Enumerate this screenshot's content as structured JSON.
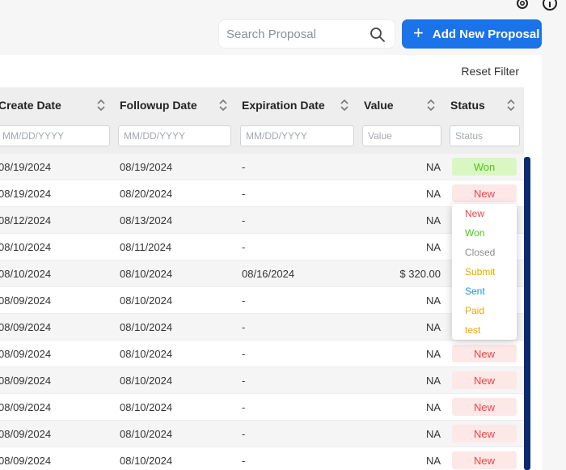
{
  "search": {
    "placeholder": "Search Proposal"
  },
  "add_button": {
    "label": "Add New Proposal"
  },
  "reset_filter": "Reset Filter",
  "columns": {
    "create_date": "Create Date",
    "followup_date": "Followup Date",
    "expiration_date": "Expiration Date",
    "value": "Value",
    "status": "Status"
  },
  "filters": {
    "create_date": "MM/DD/YYYY",
    "followup_date": "MM/DD/YYYY",
    "expiration_date": "MM/DD/YYYY",
    "value": "Value",
    "status": "Status"
  },
  "rows": [
    {
      "create": "08/19/2024",
      "followup": "08/19/2024",
      "expiration": "-",
      "value": "NA",
      "status": "Won"
    },
    {
      "create": "08/19/2024",
      "followup": "08/20/2024",
      "expiration": "-",
      "value": "NA",
      "status": "New"
    },
    {
      "create": "08/12/2024",
      "followup": "08/13/2024",
      "expiration": "-",
      "value": "NA",
      "status": ""
    },
    {
      "create": "08/10/2024",
      "followup": "08/11/2024",
      "expiration": "-",
      "value": "NA",
      "status": ""
    },
    {
      "create": "08/10/2024",
      "followup": "08/10/2024",
      "expiration": "08/16/2024",
      "value": "$ 320.00",
      "status": ""
    },
    {
      "create": "08/09/2024",
      "followup": "08/10/2024",
      "expiration": "-",
      "value": "NA",
      "status": ""
    },
    {
      "create": "08/09/2024",
      "followup": "08/10/2024",
      "expiration": "-",
      "value": "NA",
      "status": ""
    },
    {
      "create": "08/09/2024",
      "followup": "08/10/2024",
      "expiration": "-",
      "value": "NA",
      "status": "New"
    },
    {
      "create": "08/09/2024",
      "followup": "08/10/2024",
      "expiration": "-",
      "value": "NA",
      "status": "New"
    },
    {
      "create": "08/09/2024",
      "followup": "08/10/2024",
      "expiration": "-",
      "value": "NA",
      "status": "New"
    },
    {
      "create": "08/09/2024",
      "followup": "08/10/2024",
      "expiration": "-",
      "value": "NA",
      "status": "New"
    },
    {
      "create": "08/09/2024",
      "followup": "08/10/2024",
      "expiration": "-",
      "value": "NA",
      "status": "New"
    }
  ],
  "status_dropdown": [
    {
      "label": "New",
      "color": "#f04444"
    },
    {
      "label": "Won",
      "color": "#52c41a"
    },
    {
      "label": "Closed",
      "color": "#8c8c8c"
    },
    {
      "label": "Submit",
      "color": "#e8a800"
    },
    {
      "label": "Sent",
      "color": "#1890ff"
    },
    {
      "label": "Paid",
      "color": "#e8a800"
    },
    {
      "label": "test",
      "color": "#e8a800"
    }
  ],
  "colors": {
    "primary": "#1a73e8",
    "won_bg": "#d9f7c3",
    "won_text": "#52c41a",
    "new_bg": "#fde8e8",
    "new_text": "#f04444",
    "scrollbar": "#0b2a6f"
  },
  "icons": {
    "top": [
      "gear-icon",
      "info-icon"
    ],
    "search": "search-icon",
    "add": "plus-icon",
    "sort": "sort-icon"
  }
}
